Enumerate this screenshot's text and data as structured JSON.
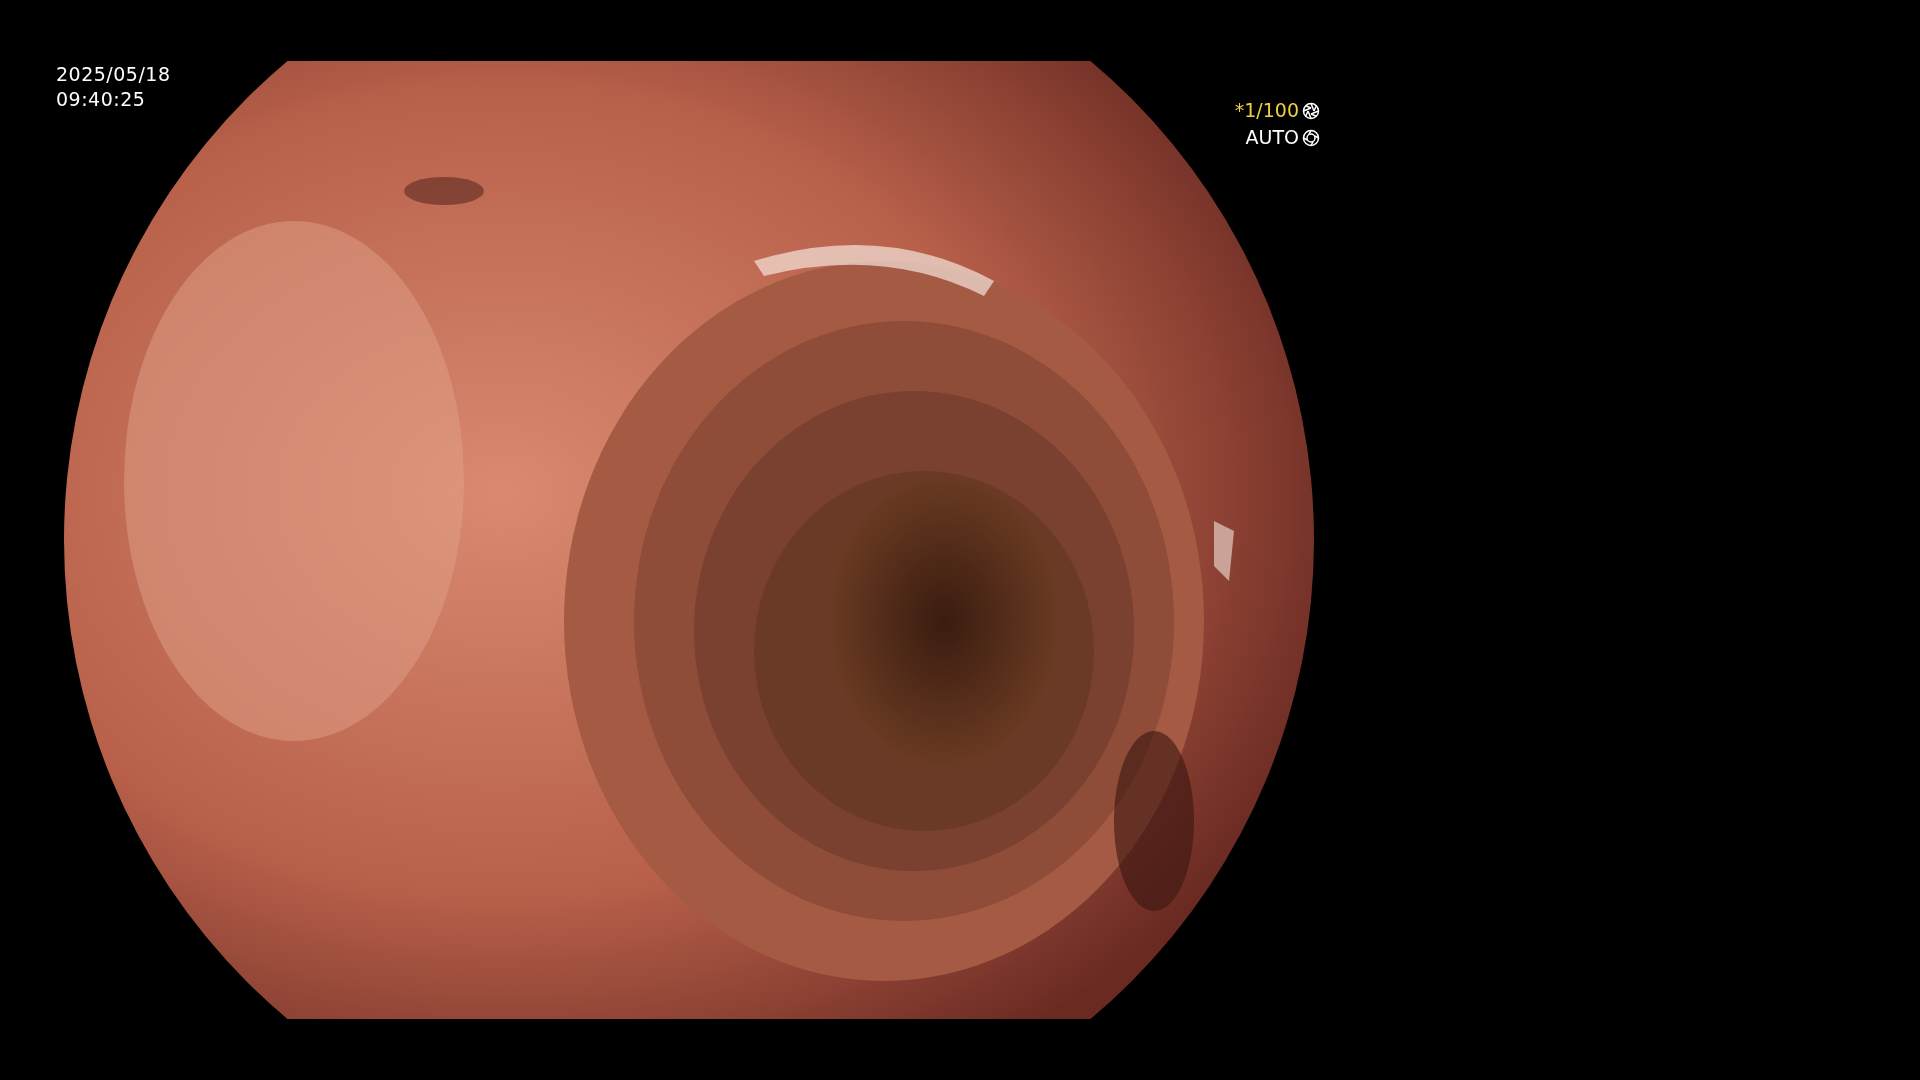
{
  "timestamp": {
    "date": "2025/05/18",
    "time": "09:40:25"
  },
  "exposure": {
    "shutter": "*1/100",
    "mode": "AUTO"
  }
}
